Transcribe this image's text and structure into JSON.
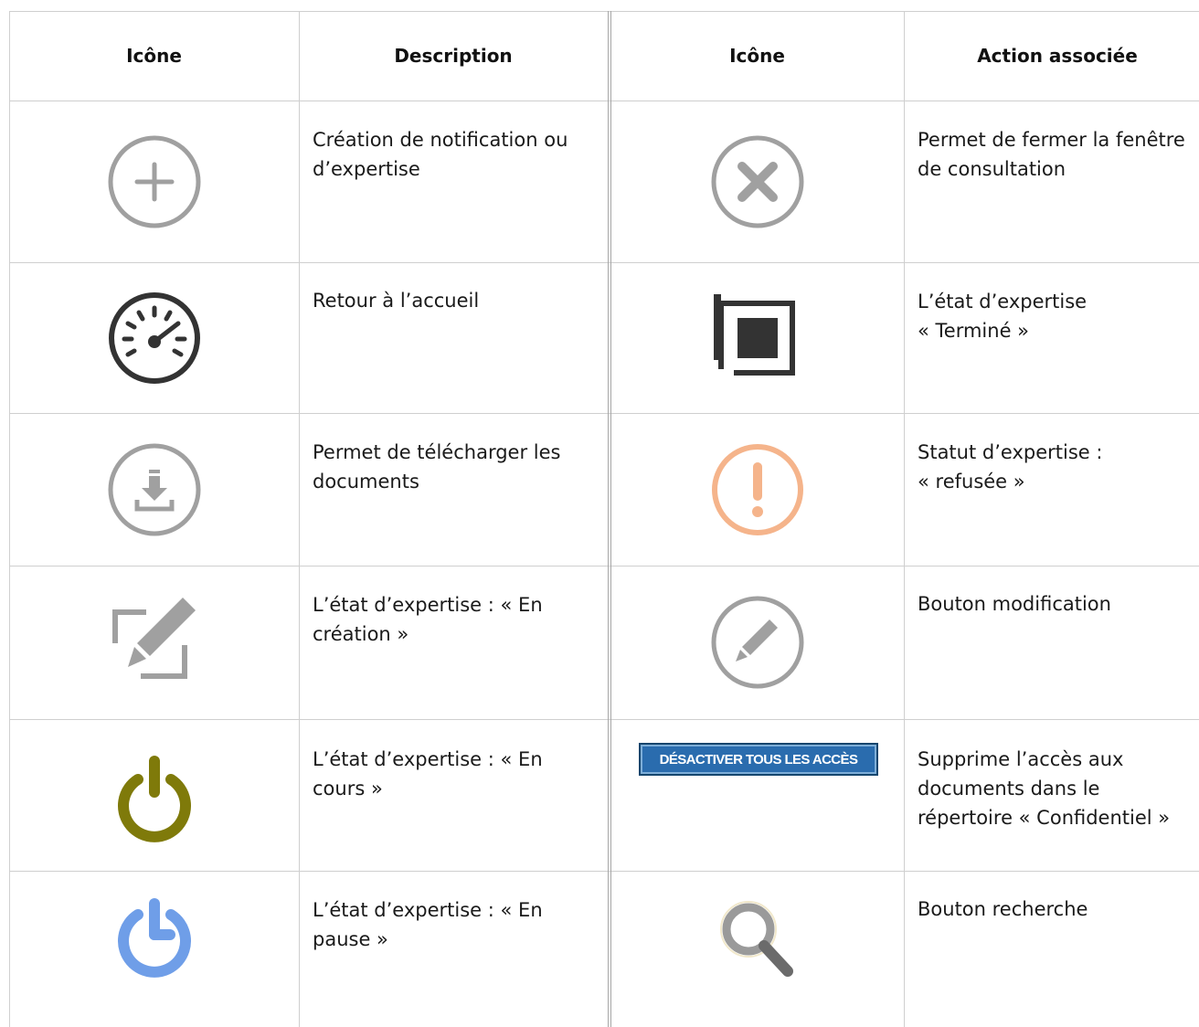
{
  "headers": {
    "icon_left": "Icône",
    "description": "Description",
    "icon_right": "Icône",
    "action": "Action associée"
  },
  "rows": [
    {
      "left_icon": "plus-circle-icon",
      "left_text": [
        "Création de notification ou",
        "d’expertise"
      ],
      "right_icon": "close-circle-icon",
      "right_text": [
        "Permet de fermer la fenêtre",
        "de consultation"
      ]
    },
    {
      "left_icon": "speedometer-icon",
      "left_text": [
        "Retour à l’accueil"
      ],
      "right_icon": "stop-square-icon",
      "right_text": [
        "L’état d’expertise",
        "« Terminé »"
      ]
    },
    {
      "left_icon": "download-circle-icon",
      "left_text": [
        "Permet de télécharger les",
        "documents"
      ],
      "right_icon": "exclamation-circle-icon",
      "right_text": [
        "Statut d’expertise :",
        "« refusée »"
      ]
    },
    {
      "left_icon": "edit-square-icon",
      "left_text": [
        "L’état d’expertise : « En",
        "création »"
      ],
      "right_icon": "pencil-circle-icon",
      "right_text": [
        "Bouton modification"
      ]
    },
    {
      "left_icon": "power-icon",
      "left_text": [
        "L’état d’expertise : « En",
        "cours »"
      ],
      "right_button": "DÉSACTIVER TOUS LES ACCÈS",
      "right_text": [
        "Supprime l’accès aux",
        "documents dans le",
        "répertoire « Confidentiel »"
      ]
    },
    {
      "left_icon": "pause-power-icon",
      "left_text": [
        "L’état d’expertise : « En",
        "pause »"
      ],
      "right_icon": "magnifier-icon",
      "right_text": [
        "Bouton recherche"
      ]
    }
  ],
  "colors": {
    "grid": "#cfcfcf",
    "icon_gray": "#a0a0a0",
    "icon_dark": "#333333",
    "power_olive": "#7f7a0a",
    "pause_blue": "#6f9ee8",
    "warning_orange": "#f5b48b",
    "button_blue": "#2a6cae"
  }
}
